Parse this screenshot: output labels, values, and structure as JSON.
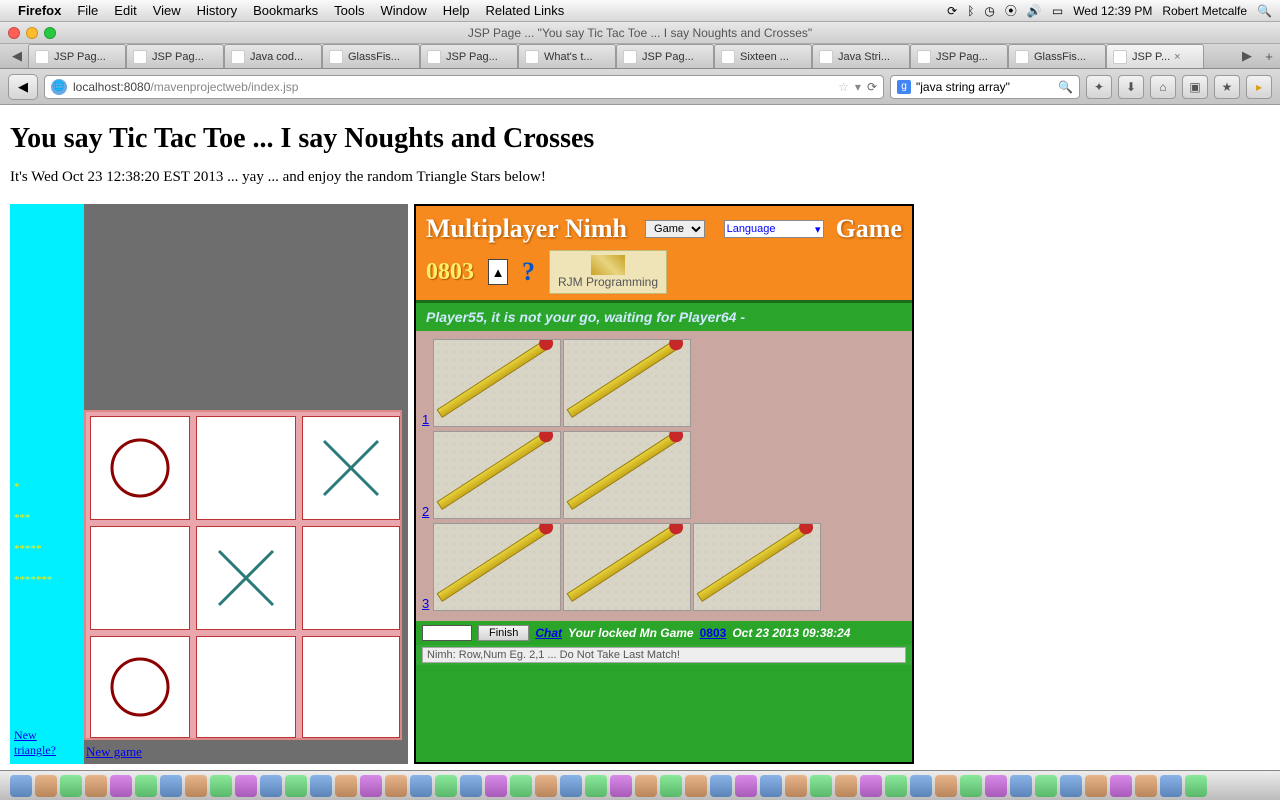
{
  "menubar": {
    "app": "Firefox",
    "items": [
      "File",
      "Edit",
      "View",
      "History",
      "Bookmarks",
      "Tools",
      "Window",
      "Help",
      "Related Links"
    ],
    "clock": "Wed 12:39 PM",
    "user": "Robert Metcalfe"
  },
  "window": {
    "title": "JSP Page ... \"You say Tic Tac Toe ... I say Noughts and Crosses\""
  },
  "tabs": [
    {
      "label": "JSP Pag..."
    },
    {
      "label": "JSP Pag..."
    },
    {
      "label": "Java cod..."
    },
    {
      "label": "GlassFis..."
    },
    {
      "label": "JSP Pag..."
    },
    {
      "label": "What's t..."
    },
    {
      "label": "JSP Pag..."
    },
    {
      "label": "Sixteen ..."
    },
    {
      "label": "Java Stri..."
    },
    {
      "label": "JSP Pag..."
    },
    {
      "label": "GlassFis..."
    },
    {
      "label": "JSP P...",
      "active": true
    }
  ],
  "url": {
    "host": "localhost",
    "port": ":8080",
    "path": "/mavenprojectweb/index.jsp"
  },
  "search": {
    "query": "\"java string array\""
  },
  "page": {
    "h1": "You say Tic Tac Toe ... I say Noughts and Crosses",
    "sub": "It's Wed Oct 23 12:38:20 EST 2013 ... yay ... and enjoy the random Triangle Stars below!"
  },
  "left": {
    "triangle_link": "New triangle?",
    "newgame": "New game",
    "dots": [
      "*",
      "***",
      "*****",
      "*******"
    ]
  },
  "nimh": {
    "title_left": "Multiplayer Nimh",
    "title_right": "Game",
    "sel_game": "Game",
    "sel_lang": "Language",
    "num": "0803",
    "rjm": "RJM Programming",
    "status": "Player55, it is not your go, waiting for Player64 -",
    "rows": [
      {
        "n": "1",
        "count": 2
      },
      {
        "n": "2",
        "count": 2
      },
      {
        "n": "3",
        "count": 3
      }
    ],
    "finish": "Finish",
    "chat": "Chat",
    "lock1": "Your locked Mn Game",
    "gameid": "0803",
    "lock2": "Oct 23 2013 09:38:24",
    "hint": "Nimh: Row,Num Eg. 2,1 ... Do Not Take Last Match!"
  }
}
